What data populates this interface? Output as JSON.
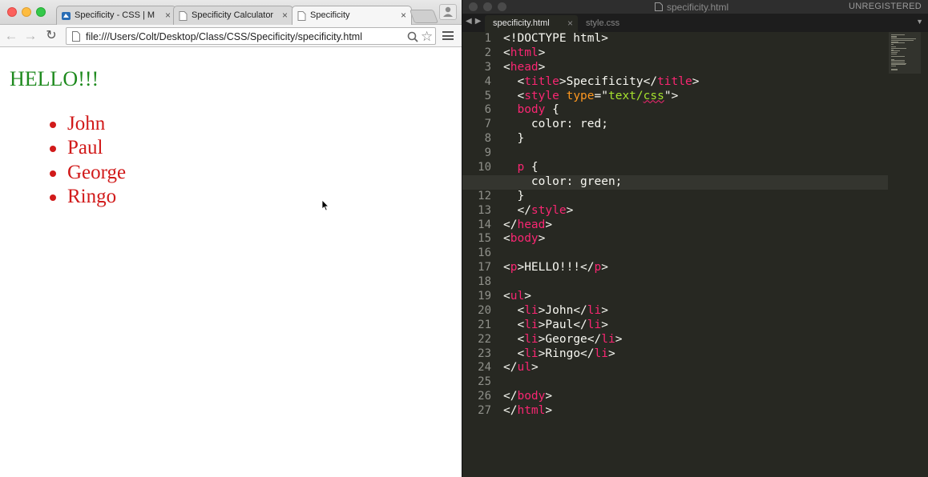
{
  "browser": {
    "tabs": [
      {
        "label": "Specificity - CSS | M",
        "icon": "page-icon"
      },
      {
        "label": "Specificity Calculator",
        "icon": "page-icon"
      },
      {
        "label": "Specificity",
        "icon": "page-icon",
        "active": true
      }
    ],
    "close_glyph": "×",
    "url": "file:///Users/Colt/Desktop/Class/CSS/Specificity/specificity.html",
    "page": {
      "heading": "HELLO!!!",
      "heading_color": "#1e8a1e",
      "list_color": "#d11a1a",
      "list": [
        "John",
        "Paul",
        "George",
        "Ringo"
      ]
    }
  },
  "editor": {
    "window_title": "specificity.html",
    "license_status": "UNREGISTERED",
    "tabs": [
      {
        "label": "specificity.html",
        "active": true
      },
      {
        "label": "style.css",
        "active": false
      }
    ],
    "current_line": 11,
    "code_lines": [
      [
        [
          "p",
          "<!DOCTYPE html>"
        ]
      ],
      [
        [
          "p",
          "<"
        ],
        [
          "t",
          "html"
        ],
        [
          "p",
          ">"
        ]
      ],
      [
        [
          "p",
          "<"
        ],
        [
          "t",
          "head"
        ],
        [
          "p",
          ">"
        ]
      ],
      [
        [
          "p",
          "  <"
        ],
        [
          "t",
          "title"
        ],
        [
          "p",
          ">Specificity</"
        ],
        [
          "t",
          "title"
        ],
        [
          "p",
          ">"
        ]
      ],
      [
        [
          "p",
          "  <"
        ],
        [
          "t",
          "style"
        ],
        [
          "p",
          " "
        ],
        [
          "a",
          "type"
        ],
        [
          "p",
          "=\""
        ],
        [
          "s",
          "text/"
        ],
        [
          "su",
          "css"
        ],
        [
          "p",
          "\">"
        ]
      ],
      [
        [
          "p",
          "  "
        ],
        [
          "t",
          "body"
        ],
        [
          "p",
          " {"
        ]
      ],
      [
        [
          "p",
          "    color: red;"
        ]
      ],
      [
        [
          "p",
          "  }"
        ]
      ],
      [
        [
          "p",
          ""
        ]
      ],
      [
        [
          "p",
          "  "
        ],
        [
          "t",
          "p"
        ],
        [
          "p",
          " {"
        ]
      ],
      [
        [
          "p",
          "    color: green;"
        ]
      ],
      [
        [
          "p",
          "  }"
        ]
      ],
      [
        [
          "p",
          "  </"
        ],
        [
          "t",
          "style"
        ],
        [
          "p",
          ">"
        ]
      ],
      [
        [
          "p",
          "</"
        ],
        [
          "t",
          "head"
        ],
        [
          "p",
          ">"
        ]
      ],
      [
        [
          "p",
          "<"
        ],
        [
          "t",
          "body"
        ],
        [
          "p",
          ">"
        ]
      ],
      [
        [
          "p",
          ""
        ]
      ],
      [
        [
          "p",
          "<"
        ],
        [
          "t",
          "p"
        ],
        [
          "p",
          ">HELLO!!!</"
        ],
        [
          "t",
          "p"
        ],
        [
          "p",
          ">"
        ]
      ],
      [
        [
          "p",
          ""
        ]
      ],
      [
        [
          "p",
          "<"
        ],
        [
          "t",
          "ul"
        ],
        [
          "p",
          ">"
        ]
      ],
      [
        [
          "p",
          "  <"
        ],
        [
          "t",
          "li"
        ],
        [
          "p",
          ">John</"
        ],
        [
          "t",
          "li"
        ],
        [
          "p",
          ">"
        ]
      ],
      [
        [
          "p",
          "  <"
        ],
        [
          "t",
          "li"
        ],
        [
          "p",
          ">Paul</"
        ],
        [
          "t",
          "li"
        ],
        [
          "p",
          ">"
        ]
      ],
      [
        [
          "p",
          "  <"
        ],
        [
          "t",
          "li"
        ],
        [
          "p",
          ">George</"
        ],
        [
          "t",
          "li"
        ],
        [
          "p",
          ">"
        ]
      ],
      [
        [
          "p",
          "  <"
        ],
        [
          "t",
          "li"
        ],
        [
          "p",
          ">Ringo</"
        ],
        [
          "t",
          "li"
        ],
        [
          "p",
          ">"
        ]
      ],
      [
        [
          "p",
          "</"
        ],
        [
          "t",
          "ul"
        ],
        [
          "p",
          ">"
        ]
      ],
      [
        [
          "p",
          ""
        ]
      ],
      [
        [
          "p",
          "</"
        ],
        [
          "t",
          "body"
        ],
        [
          "p",
          ">"
        ]
      ],
      [
        [
          "p",
          "</"
        ],
        [
          "t",
          "html"
        ],
        [
          "p",
          ">"
        ]
      ]
    ],
    "theme_colors": {
      "background": "#272822",
      "tag": "#f92672",
      "attribute": "#fd971f",
      "string": "#a6e22e",
      "text": "#f8f8f2",
      "line_number": "#8f908a"
    }
  }
}
